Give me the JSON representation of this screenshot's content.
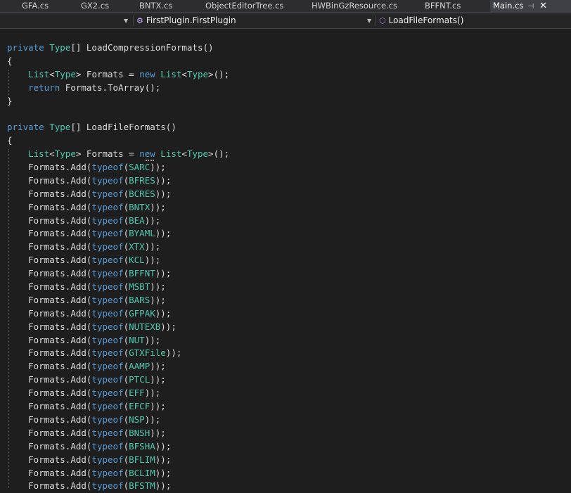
{
  "tabs": [
    {
      "label": "GFA.cs"
    },
    {
      "label": "GX2.cs"
    },
    {
      "label": "BNTX.cs"
    },
    {
      "label": "ObjectEditorTree.cs"
    },
    {
      "label": "HWBinGzResource.cs"
    },
    {
      "label": "BFFNT.cs"
    },
    {
      "label": "Main.cs",
      "active": true
    }
  ],
  "navbar": {
    "class_name": "FirstPlugin.FirstPlugin",
    "member_name": "LoadFileFormats()"
  },
  "colors": {
    "keyword": "#569cd6",
    "type": "#4ec9b0",
    "text": "#dcdcdc",
    "background": "#1e1e1e"
  },
  "code": {
    "lines": [
      "private Type[] LoadCompressionFormats()",
      "{",
      "    List<Type> Formats = new List<Type>();",
      "    return Formats.ToArray();",
      "}",
      "",
      "private Type[] LoadFileFormats()",
      "{",
      "    List<Type> Formats = new List<Type>();",
      "    Formats.Add(typeof(SARC));",
      "    Formats.Add(typeof(BFRES));",
      "    Formats.Add(typeof(BCRES));",
      "    Formats.Add(typeof(BNTX));",
      "    Formats.Add(typeof(BEA));",
      "    Formats.Add(typeof(BYAML));",
      "    Formats.Add(typeof(XTX));",
      "    Formats.Add(typeof(KCL));",
      "    Formats.Add(typeof(BFFNT));",
      "    Formats.Add(typeof(MSBT));",
      "    Formats.Add(typeof(BARS));",
      "    Formats.Add(typeof(GFPAK));",
      "    Formats.Add(typeof(NUTEXB));",
      "    Formats.Add(typeof(NUT));",
      "    Formats.Add(typeof(GTXFile));",
      "    Formats.Add(typeof(AAMP));",
      "    Formats.Add(typeof(PTCL));",
      "    Formats.Add(typeof(EFF));",
      "    Formats.Add(typeof(EFCF));",
      "    Formats.Add(typeof(NSP));",
      "    Formats.Add(typeof(BNSH));",
      "    Formats.Add(typeof(BFSHA));",
      "    Formats.Add(typeof(BFLIM));",
      "    Formats.Add(typeof(BCLIM));",
      "    Formats.Add(typeof(BFSTM));"
    ]
  }
}
